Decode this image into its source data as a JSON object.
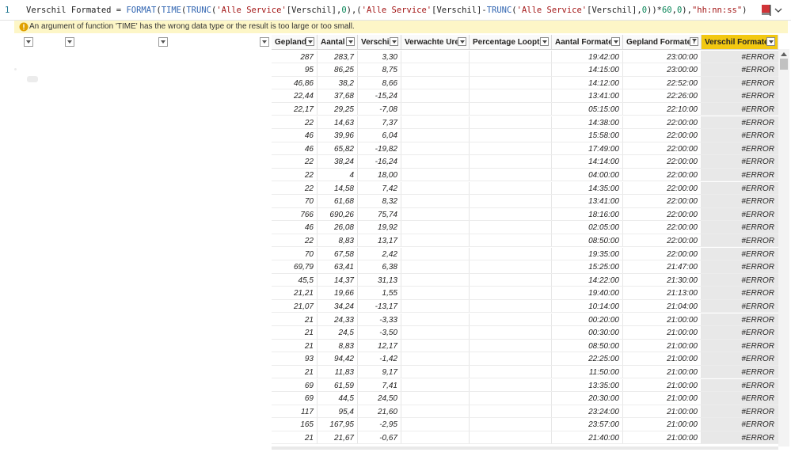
{
  "formula": {
    "line_no": "1",
    "tokens": [
      {
        "t": "id",
        "v": "Verschil Formated = "
      },
      {
        "t": "fn",
        "v": "FORMAT"
      },
      {
        "t": "op",
        "v": "("
      },
      {
        "t": "fn",
        "v": "TIME"
      },
      {
        "t": "op",
        "v": "("
      },
      {
        "t": "fn",
        "v": "TRUNC"
      },
      {
        "t": "op",
        "v": "("
      },
      {
        "t": "str",
        "v": "'Alle Service'"
      },
      {
        "t": "op",
        "v": "[Verschil],"
      },
      {
        "t": "num",
        "v": "0"
      },
      {
        "t": "op",
        "v": "),("
      },
      {
        "t": "str",
        "v": "'Alle Service'"
      },
      {
        "t": "op",
        "v": "[Verschil]-"
      },
      {
        "t": "fn",
        "v": "TRUNC"
      },
      {
        "t": "op",
        "v": "("
      },
      {
        "t": "str",
        "v": "'Alle Service'"
      },
      {
        "t": "op",
        "v": "[Verschil],"
      },
      {
        "t": "num",
        "v": "0"
      },
      {
        "t": "op",
        "v": "))*"
      },
      {
        "t": "num",
        "v": "60"
      },
      {
        "t": "op",
        "v": ","
      },
      {
        "t": "num",
        "v": "0"
      },
      {
        "t": "op",
        "v": "),"
      },
      {
        "t": "str",
        "v": "\"hh:nn:ss\""
      },
      {
        "t": "op",
        "v": ")"
      }
    ]
  },
  "error": {
    "message": "An argument of function 'TIME' has the wrong data type or the result is too large or too small."
  },
  "colors": {
    "accent": "#f2c811",
    "error_bg": "#fdf6c7",
    "error_icon": "#e0a100"
  },
  "columns": [
    {
      "label": "Gepland"
    },
    {
      "label": "Aantal"
    },
    {
      "label": "Verschil"
    },
    {
      "label": "Verwachte Uren"
    },
    {
      "label": "Percentage Looptijd"
    },
    {
      "label": "Aantal Formated"
    },
    {
      "label": "Gepland Formated",
      "sorted": true
    },
    {
      "label": "Verschil Formated",
      "active": true
    }
  ],
  "rows": [
    [
      "287",
      "283,7",
      "3,30",
      "",
      "",
      "19:42:00",
      "23:00:00",
      "#ERROR"
    ],
    [
      "95",
      "86,25",
      "8,75",
      "",
      "",
      "14:15:00",
      "23:00:00",
      "#ERROR"
    ],
    [
      "46,86",
      "38,2",
      "8,66",
      "",
      "",
      "14:12:00",
      "22:52:00",
      "#ERROR"
    ],
    [
      "22,44",
      "37,68",
      "-15,24",
      "",
      "",
      "13:41:00",
      "22:26:00",
      "#ERROR"
    ],
    [
      "22,17",
      "29,25",
      "-7,08",
      "",
      "",
      "05:15:00",
      "22:10:00",
      "#ERROR"
    ],
    [
      "22",
      "14,63",
      "7,37",
      "",
      "",
      "14:38:00",
      "22:00:00",
      "#ERROR"
    ],
    [
      "46",
      "39,96",
      "6,04",
      "",
      "",
      "15:58:00",
      "22:00:00",
      "#ERROR"
    ],
    [
      "46",
      "65,82",
      "-19,82",
      "",
      "",
      "17:49:00",
      "22:00:00",
      "#ERROR"
    ],
    [
      "22",
      "38,24",
      "-16,24",
      "",
      "",
      "14:14:00",
      "22:00:00",
      "#ERROR"
    ],
    [
      "22",
      "4",
      "18,00",
      "",
      "",
      "04:00:00",
      "22:00:00",
      "#ERROR"
    ],
    [
      "22",
      "14,58",
      "7,42",
      "",
      "",
      "14:35:00",
      "22:00:00",
      "#ERROR"
    ],
    [
      "70",
      "61,68",
      "8,32",
      "",
      "",
      "13:41:00",
      "22:00:00",
      "#ERROR"
    ],
    [
      "766",
      "690,26",
      "75,74",
      "",
      "",
      "18:16:00",
      "22:00:00",
      "#ERROR"
    ],
    [
      "46",
      "26,08",
      "19,92",
      "",
      "",
      "02:05:00",
      "22:00:00",
      "#ERROR"
    ],
    [
      "22",
      "8,83",
      "13,17",
      "",
      "",
      "08:50:00",
      "22:00:00",
      "#ERROR"
    ],
    [
      "70",
      "67,58",
      "2,42",
      "",
      "",
      "19:35:00",
      "22:00:00",
      "#ERROR"
    ],
    [
      "69,79",
      "63,41",
      "6,38",
      "",
      "",
      "15:25:00",
      "21:47:00",
      "#ERROR"
    ],
    [
      "45,5",
      "14,37",
      "31,13",
      "",
      "",
      "14:22:00",
      "21:30:00",
      "#ERROR"
    ],
    [
      "21,21",
      "19,66",
      "1,55",
      "",
      "",
      "19:40:00",
      "21:13:00",
      "#ERROR"
    ],
    [
      "21,07",
      "34,24",
      "-13,17",
      "",
      "",
      "10:14:00",
      "21:04:00",
      "#ERROR"
    ],
    [
      "21",
      "24,33",
      "-3,33",
      "",
      "",
      "00:20:00",
      "21:00:00",
      "#ERROR"
    ],
    [
      "21",
      "24,5",
      "-3,50",
      "",
      "",
      "00:30:00",
      "21:00:00",
      "#ERROR"
    ],
    [
      "21",
      "8,83",
      "12,17",
      "",
      "",
      "08:50:00",
      "21:00:00",
      "#ERROR"
    ],
    [
      "93",
      "94,42",
      "-1,42",
      "",
      "",
      "22:25:00",
      "21:00:00",
      "#ERROR"
    ],
    [
      "21",
      "11,83",
      "9,17",
      "",
      "",
      "11:50:00",
      "21:00:00",
      "#ERROR"
    ],
    [
      "69",
      "61,59",
      "7,41",
      "",
      "",
      "13:35:00",
      "21:00:00",
      "#ERROR"
    ],
    [
      "69",
      "44,5",
      "24,50",
      "",
      "",
      "20:30:00",
      "21:00:00",
      "#ERROR"
    ],
    [
      "117",
      "95,4",
      "21,60",
      "",
      "",
      "23:24:00",
      "21:00:00",
      "#ERROR"
    ],
    [
      "165",
      "167,95",
      "-2,95",
      "",
      "",
      "23:57:00",
      "21:00:00",
      "#ERROR"
    ],
    [
      "21",
      "21,67",
      "-0,67",
      "",
      "",
      "21:40:00",
      "21:00:00",
      "#ERROR"
    ]
  ]
}
